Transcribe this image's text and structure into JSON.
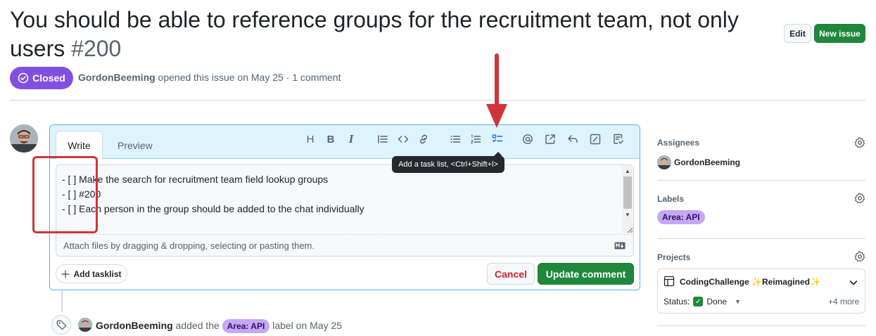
{
  "issue": {
    "title": "You should be able to reference groups for the recruitment team, not only users",
    "number": "#200",
    "state": "Closed",
    "author": "GordonBeeming",
    "meta_text": " opened this issue on May 25 · 1 comment"
  },
  "header_actions": {
    "edit_label": "Edit",
    "new_issue_label": "New issue"
  },
  "editor": {
    "tabs": {
      "write": "Write",
      "preview": "Preview"
    },
    "toolbar": {
      "heading": "H",
      "bold": "B",
      "italic": "I",
      "tooltip": "Add a task list, <Ctrl+Shift+l>"
    },
    "lines": [
      "- [ ] Make the search for recruitment team field lookup groups",
      "- [ ] #200",
      "- [ ] Each person in the group should be added to the chat individually"
    ],
    "attach_hint": "Attach files by dragging & dropping, selecting or pasting them.",
    "add_tasklist_label": "Add tasklist",
    "cancel_label": "Cancel",
    "update_label": "Update comment"
  },
  "timeline": {
    "actor": "GordonBeeming",
    "added_text": " added the ",
    "label": "Area: API",
    "after_text": " label on May 25"
  },
  "sidebar": {
    "assignees": {
      "heading": "Assignees",
      "user": "GordonBeeming"
    },
    "labels": {
      "heading": "Labels",
      "label": "Area: API"
    },
    "projects": {
      "heading": "Projects",
      "name": "CodingChallenge ✨Reimagined✨",
      "status_label": "Status:",
      "status_value": "Done",
      "more_label": "+4 more"
    }
  },
  "colors": {
    "closed": "#8250df",
    "primary_button": "#1f883d",
    "label_bg": "#c5a7f5",
    "annotation": "#d13438"
  },
  "icons": [
    "closed-check-icon",
    "gear-icon",
    "tag-icon",
    "task-list-icon",
    "table-icon",
    "chevron-down-icon",
    "plus-icon",
    "markdown-icon"
  ]
}
